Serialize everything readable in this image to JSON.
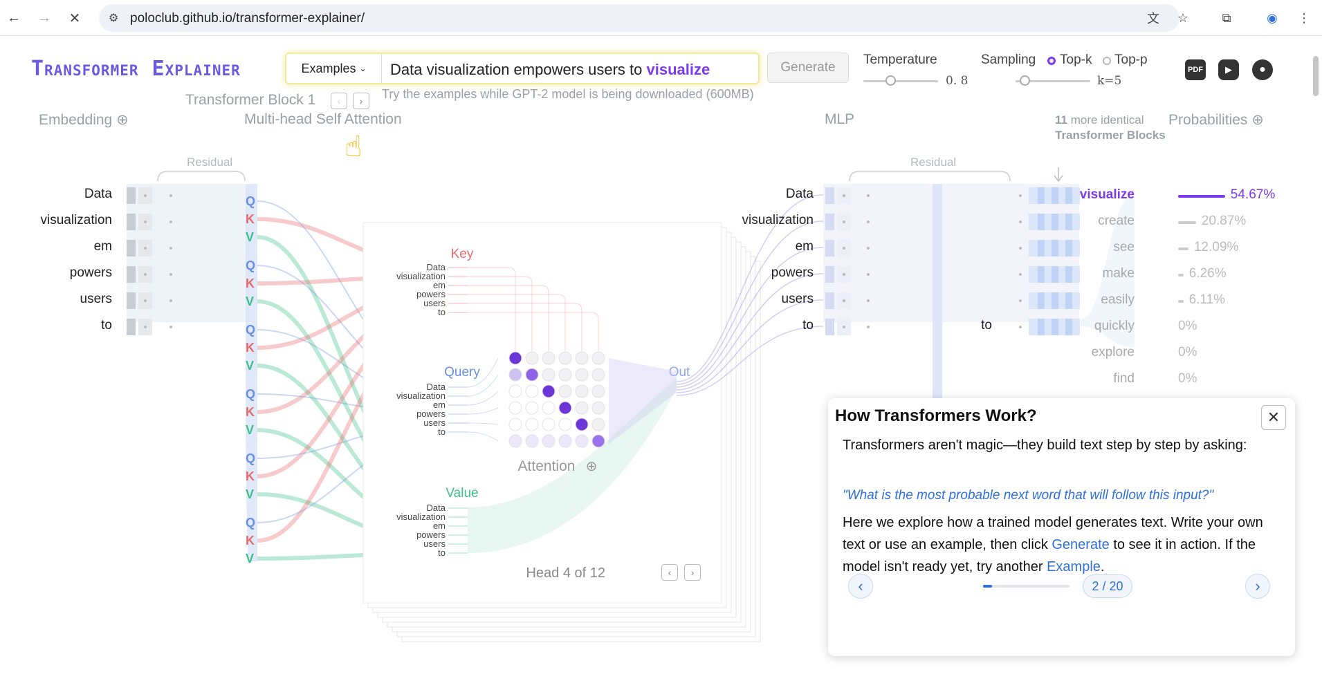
{
  "browser": {
    "url": "poloclub.github.io/transformer-explainer/"
  },
  "app": {
    "logo": "Transformer Explainer",
    "examples_label": "Examples",
    "input_text": "Data visualization empowers users to",
    "input_predicted": "visualize",
    "generate_label": "Generate",
    "hint": "Try the examples while GPT-2 model is being downloaded (600MB)",
    "temperature_label": "Temperature",
    "temperature_value": 0.8,
    "temperature_display": "0. 8",
    "sampling_label": "Sampling",
    "topk_label": "Top-k",
    "topp_label": "Top-p",
    "k_value": 5,
    "k_display": "k=5",
    "icons": [
      "pdf-icon",
      "youtube-icon",
      "github-icon"
    ]
  },
  "sections": {
    "block": "Transformer Block 1",
    "embedding": "Embedding",
    "mhsa": "Multi-head Self Attention",
    "mlp": "MLP",
    "probabilities": "Probabilities",
    "residual": "Residual",
    "more_blocks_count": "11",
    "more_blocks_text": "more identical",
    "more_blocks_label": "Transformer Blocks"
  },
  "tokens": [
    "Data",
    "visualization",
    "em",
    "powers",
    "users",
    "to"
  ],
  "attention": {
    "key": "Key",
    "query": "Query",
    "value": "Value",
    "out": "Out",
    "attention_label": "Attention",
    "head_info": "Head 4 of 12",
    "qkv_letters": [
      "Q",
      "K",
      "V"
    ]
  },
  "mlp_token": "to",
  "probabilities": [
    {
      "word": "visualize",
      "pct": "54.67%",
      "value": 54.67
    },
    {
      "word": "create",
      "pct": "20.87%",
      "value": 20.87
    },
    {
      "word": "see",
      "pct": "12.09%",
      "value": 12.09
    },
    {
      "word": "make",
      "pct": "6.26%",
      "value": 6.26
    },
    {
      "word": "easily",
      "pct": "6.11%",
      "value": 6.11
    },
    {
      "word": "quickly",
      "pct": "0%",
      "value": 0
    },
    {
      "word": "explore",
      "pct": "0%",
      "value": 0
    },
    {
      "word": "find",
      "pct": "0%",
      "value": 0
    }
  ],
  "tour": {
    "title": "How Transformers Work?",
    "p1": "Transformers aren't magic—they build text step by step by asking:",
    "question": "\"What is the most probable next word that will follow this input?\"",
    "p2_a": "Here we explore how a trained model generates text. Write your own text or use an example, then click ",
    "p2_link1": "Generate",
    "p2_b": " to see it in action. If the model isn't ready yet, try another ",
    "p2_link2": "Example",
    "p2_c": ".",
    "page": "2 / 20",
    "page_current": 2,
    "page_total": 20,
    "close": "✕",
    "prev": "‹",
    "next": "›"
  },
  "colors": {
    "accent": "#7c3aed",
    "key": "#e86b6b",
    "query": "#6a8fe0",
    "value": "#3fbf8a",
    "link": "#2f6fdb"
  }
}
